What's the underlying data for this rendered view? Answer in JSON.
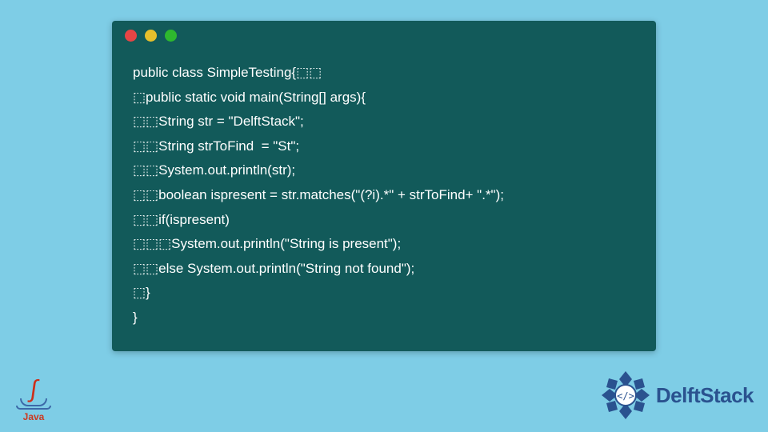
{
  "code": {
    "lines": [
      "public class SimpleTesting{⬚⬚",
      "⬚public static void main(String[] args){",
      "⬚⬚String str = \"DelftStack\";",
      "⬚⬚String strToFind  = \"St\";",
      "⬚⬚System.out.println(str);",
      "⬚⬚boolean ispresent = str.matches(\"(?i).*\" + strToFind+ \".*\");",
      "⬚⬚if(ispresent)",
      "⬚⬚⬚System.out.println(\"String is present\");",
      "⬚⬚else System.out.println(\"String not found\");",
      "⬚}",
      "}"
    ]
  },
  "java_logo": {
    "label": "Java"
  },
  "delft_logo": {
    "text": "DelftStack"
  }
}
